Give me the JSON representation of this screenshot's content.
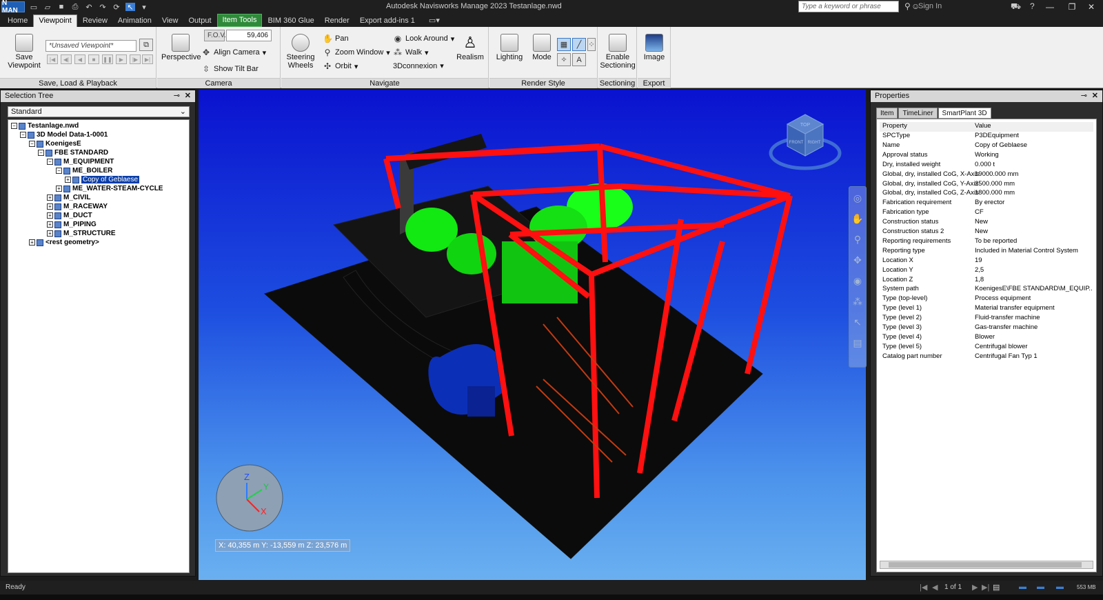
{
  "titlebar": {
    "logo": "N MAN",
    "title": "Autodesk Navisworks Manage 2023    Testanlage.nwd",
    "search_placeholder": "Type a keyword or phrase",
    "signin": "Sign In"
  },
  "tabs": [
    {
      "label": "Home"
    },
    {
      "label": "Viewpoint",
      "active": true
    },
    {
      "label": "Review"
    },
    {
      "label": "Animation"
    },
    {
      "label": "View"
    },
    {
      "label": "Output"
    },
    {
      "label": "Item Tools",
      "contextual": true
    },
    {
      "label": "BIM 360 Glue"
    },
    {
      "label": "Render"
    },
    {
      "label": "Export add-ins 1"
    }
  ],
  "ribbon": {
    "save_viewpoint": "Save Viewpoint",
    "viewpoint_combo": "*Unsaved Viewpoint*",
    "panel_save": "Save, Load & Playback",
    "perspective": "Perspective",
    "fov_label": "F.O.V.",
    "fov_value": "59,406",
    "align_camera": "Align Camera",
    "show_tilt_bar": "Show Tilt Bar",
    "panel_camera": "Camera",
    "steering_wheels": "Steering Wheels",
    "pan": "Pan",
    "zoom_window": "Zoom Window",
    "orbit": "Orbit",
    "look_around": "Look Around",
    "walk": "Walk",
    "connexion": "3Dconnexion",
    "realism": "Realism",
    "panel_navigate": "Navigate",
    "lighting": "Lighting",
    "mode": "Mode",
    "panel_render_style": "Render Style",
    "enable_sectioning": "Enable Sectioning",
    "panel_sectioning": "Sectioning",
    "image": "Image",
    "panel_export": "Export"
  },
  "selection_tree": {
    "title": "Selection Tree",
    "mode": "Standard",
    "nodes": [
      {
        "label": "Testanlage.nwd",
        "depth": 0
      },
      {
        "label": "3D Model Data-1-0001",
        "depth": 1
      },
      {
        "label": "KoenigesE",
        "depth": 2
      },
      {
        "label": "FBE STANDARD",
        "depth": 3
      },
      {
        "label": "M_EQUIPMENT",
        "depth": 4
      },
      {
        "label": "ME_BOILER",
        "depth": 5
      },
      {
        "label": "Copy of Geblaese",
        "depth": 6,
        "selected": true
      },
      {
        "label": "ME_WATER-STEAM-CYCLE",
        "depth": 5
      },
      {
        "label": "M_CIVIL",
        "depth": 4
      },
      {
        "label": "M_RACEWAY",
        "depth": 4
      },
      {
        "label": "M_DUCT",
        "depth": 4
      },
      {
        "label": "M_PIPING",
        "depth": 4
      },
      {
        "label": "M_STRUCTURE",
        "depth": 4
      },
      {
        "label": "<rest geometry>",
        "depth": 2
      }
    ]
  },
  "viewport": {
    "coords": "X: 40,355 m  Y: -13,559 m  Z: 23,576 m",
    "axis_z": "Z",
    "axis_y": "Y",
    "axis_x": "X",
    "viewcube_top": "TOP",
    "viewcube_front": "FRONT",
    "viewcube_right": "RIGHT",
    "colors": {
      "structure": "#ff1a1a",
      "equipment": "#1dff1d",
      "blower": "#0c2fb8",
      "floor": "#0a0a0a",
      "stairs": "#c23a12"
    }
  },
  "properties": {
    "title": "Properties",
    "tabs": [
      {
        "label": "Item"
      },
      {
        "label": "TimeLiner"
      },
      {
        "label": "SmartPlant 3D",
        "active": true
      }
    ],
    "header": {
      "key": "Property",
      "value": "Value"
    },
    "rows": [
      {
        "key": "SPCType",
        "value": "P3DEquipment"
      },
      {
        "key": "Name",
        "value": "Copy of Geblaese"
      },
      {
        "key": "Approval status",
        "value": "Working"
      },
      {
        "key": "Dry, installed weight",
        "value": "0.000 t"
      },
      {
        "key": "Global, dry, installed CoG, X-Axis",
        "value": "19000.000 mm"
      },
      {
        "key": "Global, dry, installed CoG, Y-Axis",
        "value": "2500.000 mm"
      },
      {
        "key": "Global, dry, installed CoG, Z-Axis",
        "value": "1800.000 mm"
      },
      {
        "key": "Fabrication requirement",
        "value": "By erector"
      },
      {
        "key": "Fabrication type",
        "value": "CF"
      },
      {
        "key": "Construction status",
        "value": "New"
      },
      {
        "key": "Construction status 2",
        "value": "New"
      },
      {
        "key": "Reporting requirements",
        "value": "To be reported"
      },
      {
        "key": "Reporting type",
        "value": "Included in Material Control System"
      },
      {
        "key": "Location X",
        "value": "19"
      },
      {
        "key": "Location Y",
        "value": "2,5"
      },
      {
        "key": "Location Z",
        "value": "1,8"
      },
      {
        "key": "System path",
        "value": "KoenigesE\\FBE STANDARD\\M_EQUIP..."
      },
      {
        "key": "Type (top-level)",
        "value": "Process equipment"
      },
      {
        "key": "Type (level 1)",
        "value": "Material transfer equipment"
      },
      {
        "key": "Type (level 2)",
        "value": "Fluid-transfer machine"
      },
      {
        "key": "Type (level 3)",
        "value": "Gas-transfer machine"
      },
      {
        "key": "Type (level 4)",
        "value": "Blower"
      },
      {
        "key": "Type (level 5)",
        "value": "Centrifugal blower"
      },
      {
        "key": "Catalog part number",
        "value": "Centrifugal Fan Typ 1"
      }
    ]
  },
  "statusbar": {
    "status": "Ready",
    "pager": "1 of 1",
    "memory": "553 MB"
  }
}
